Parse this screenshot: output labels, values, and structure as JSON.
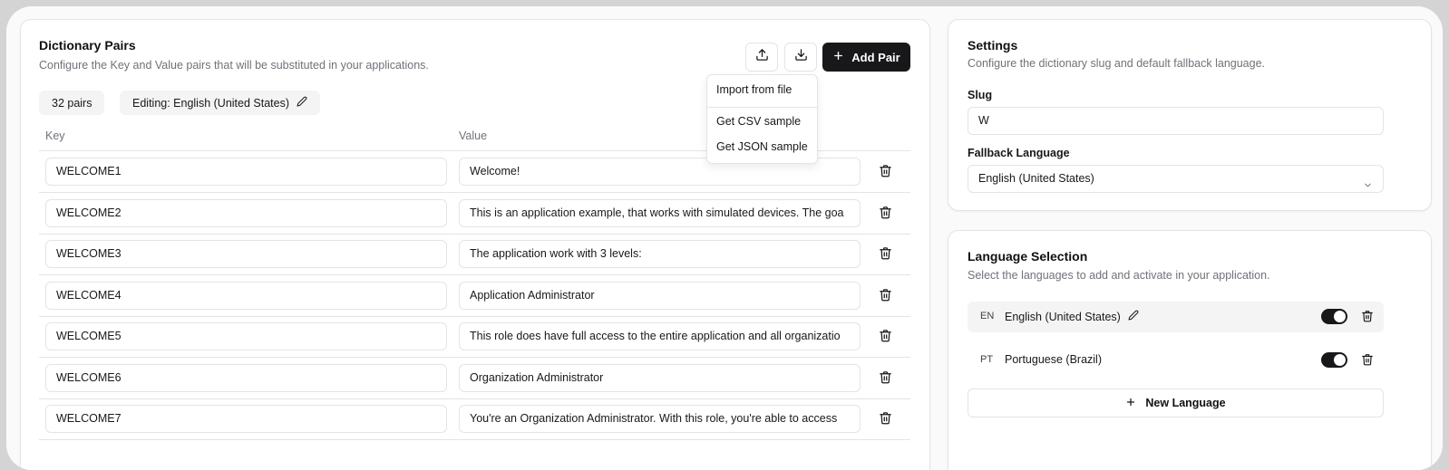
{
  "dictionary": {
    "title": "Dictionary Pairs",
    "description": "Configure the Key and Value pairs that will be substituted in your applications.",
    "add_label": "Add Pair",
    "pairs_count": "32 pairs",
    "editing_label": "Editing: English (United States)",
    "col_key": "Key",
    "col_value": "Value",
    "rows": [
      {
        "key": "WELCOME1",
        "value": "Welcome!"
      },
      {
        "key": "WELCOME2",
        "value": "This is an application example, that works with simulated devices. The goa"
      },
      {
        "key": "WELCOME3",
        "value": "The application work with 3 levels:"
      },
      {
        "key": "WELCOME4",
        "value": "Application Administrator"
      },
      {
        "key": "WELCOME5",
        "value": "This role does have full access to the entire application and all organizatio"
      },
      {
        "key": "WELCOME6",
        "value": "Organization Administrator"
      },
      {
        "key": "WELCOME7",
        "value": "You're an Organization Administrator. With this role, you're able to access"
      }
    ]
  },
  "menu": {
    "import": "Import from file",
    "csv": "Get CSV sample",
    "json": "Get JSON sample"
  },
  "settings": {
    "title": "Settings",
    "description": "Configure the dictionary slug and default fallback language.",
    "slug_label": "Slug",
    "slug_value": "W",
    "fallback_label": "Fallback Language",
    "fallback_value": "English (United States)"
  },
  "languages": {
    "title": "Language Selection",
    "description": "Select the languages to add and activate in your application.",
    "items": [
      {
        "code": "EN",
        "name": "English (United States)",
        "active": true
      },
      {
        "code": "PT",
        "name": "Portuguese (Brazil)",
        "active": true
      }
    ],
    "new_label": "New Language"
  },
  "icons": [
    "upload-icon",
    "download-icon",
    "plus-icon",
    "pencil-icon",
    "trash-icon",
    "chevron-down-icon"
  ]
}
